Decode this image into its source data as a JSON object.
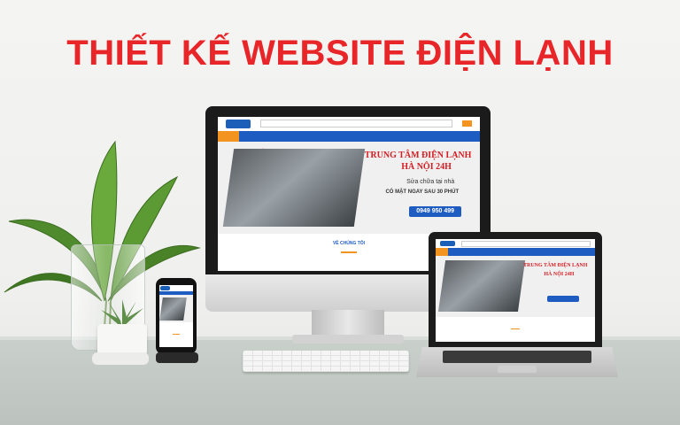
{
  "headline": "THIẾT KẾ WEBSITE ĐIỆN LẠNH",
  "desktop_site": {
    "hero_title_1": "TRUNG TÂM ĐIỆN LẠNH",
    "hero_title_2": "HÀ NỘI 24H",
    "hero_sub_1": "Sửa chữa tại nhà",
    "hero_sub_2": "CÓ MẶT NGAY SAU 30 PHÚT",
    "hotline": "0949 950 499",
    "section_label": "VỀ CHÚNG TÔI"
  },
  "laptop_site": {
    "hero_title_1": "TRUNG TÂM ĐIỆN LẠNH",
    "hero_title_2": "HÀ NỘI 24H"
  },
  "colors": {
    "headline": "#e8262a",
    "brand_blue": "#1f5cc2",
    "accent_orange": "#f39320"
  }
}
